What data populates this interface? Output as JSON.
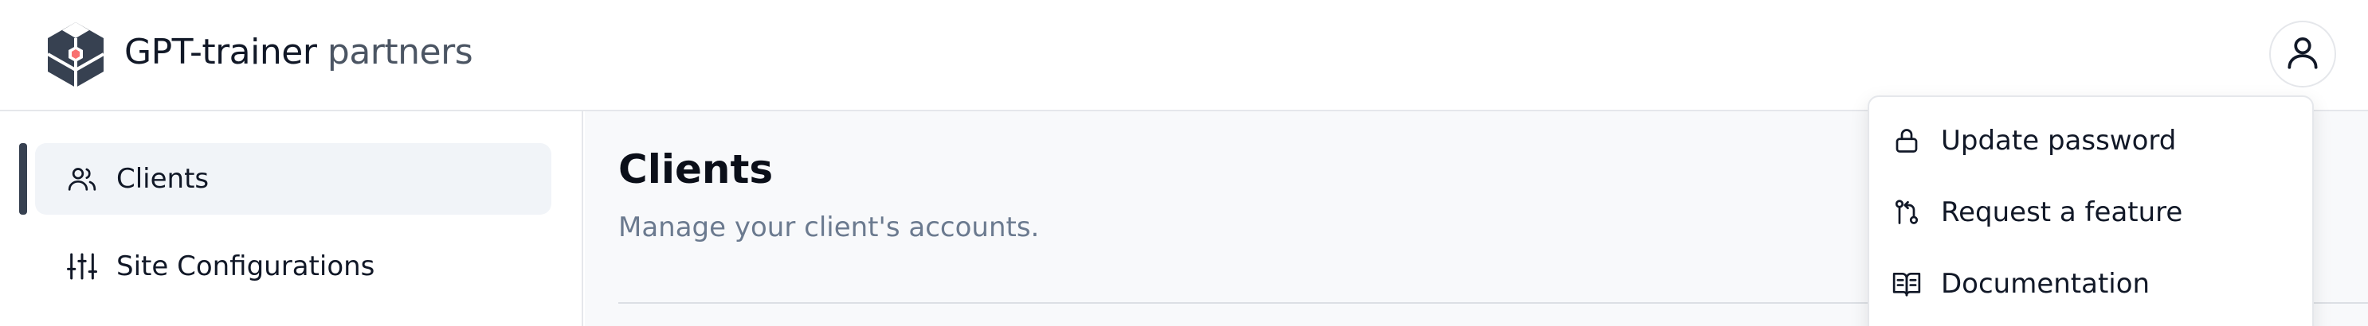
{
  "header": {
    "brand_main": "GPT-trainer",
    "brand_suffix": " partners",
    "logo_icon": "hexagon-logo-icon",
    "avatar_icon": "user-icon"
  },
  "sidebar": {
    "items": [
      {
        "label": "Clients",
        "icon": "users-icon",
        "active": true
      },
      {
        "label": "Site Configurations",
        "icon": "sliders-icon",
        "active": false
      }
    ]
  },
  "main": {
    "title": "Clients",
    "subtitle": "Manage your client's accounts."
  },
  "user_menu": {
    "items": [
      {
        "label": "Update password",
        "icon": "lock-icon"
      },
      {
        "label": "Request a feature",
        "icon": "git-pull-request-icon"
      },
      {
        "label": "Documentation",
        "icon": "book-open-icon"
      }
    ]
  },
  "colors": {
    "accent_logo": "#374151",
    "logo_dot": "#f87171",
    "active_bg": "#f1f4f8",
    "main_bg": "#f8f9fb",
    "subtitle": "#6b7a8f"
  }
}
